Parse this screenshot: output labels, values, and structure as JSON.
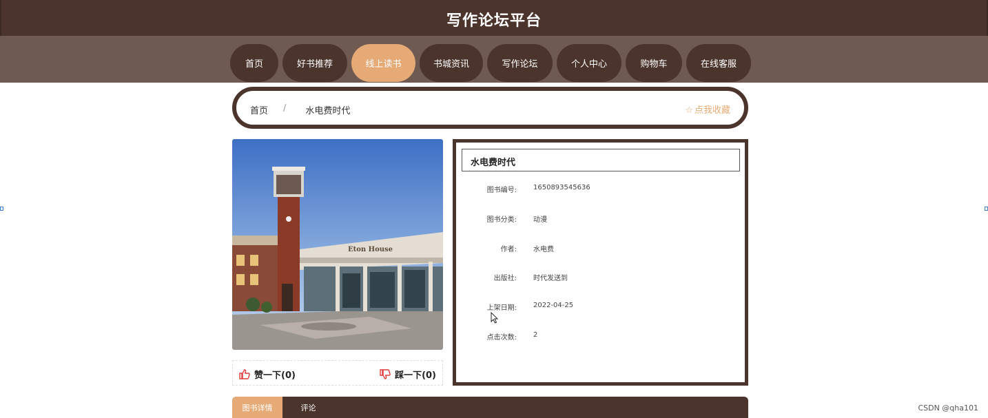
{
  "header": {
    "title": "写作论坛平台"
  },
  "nav": {
    "items": [
      {
        "label": "首页",
        "active": false
      },
      {
        "label": "好书推荐",
        "active": false
      },
      {
        "label": "线上读书",
        "active": true
      },
      {
        "label": "书城资讯",
        "active": false
      },
      {
        "label": "写作论坛",
        "active": false
      },
      {
        "label": "个人中心",
        "active": false
      },
      {
        "label": "购物车",
        "active": false
      },
      {
        "label": "在线客服",
        "active": false
      }
    ]
  },
  "breadcrumb": {
    "home": "首页",
    "separator": "/",
    "current": "水电费时代",
    "favorite_icon": "☆",
    "favorite_label": "点我收藏"
  },
  "book": {
    "cover_icon": "building-photo",
    "title": "水电费时代",
    "fields": [
      {
        "label": "图书编号:",
        "value": "1650893545636"
      },
      {
        "label": "图书分类:",
        "value": "动漫"
      },
      {
        "label": "作者:",
        "value": "水电费"
      },
      {
        "label": "出版社:",
        "value": "时代发送到"
      },
      {
        "label": "上架日期:",
        "value": "2022-04-25"
      },
      {
        "label": "点击次数:",
        "value": "2"
      }
    ]
  },
  "votes": {
    "like_label": "赞一下(0)",
    "dislike_label": "踩一下(0)"
  },
  "tabs": [
    {
      "label": "图书详情",
      "active": true
    },
    {
      "label": "评论",
      "active": false
    }
  ],
  "watermark": "CSDN @qha101",
  "colors": {
    "primary": "#4b342b",
    "nav_bg": "#6f5a52",
    "accent": "#e5aa76",
    "vote_icon": "#e03a3a"
  }
}
